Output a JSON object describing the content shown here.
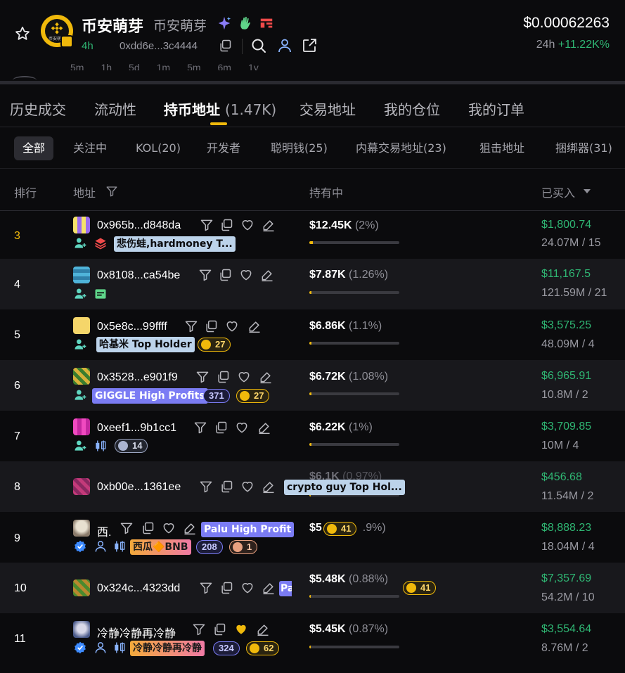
{
  "header": {
    "token_name": "币安萌芽",
    "token_subname": "币安萌芽",
    "logo_text": "币安萌芽",
    "age": "4h",
    "address": "0xdd6e...3c4444",
    "price": "$0.00062263",
    "change_label": "24h",
    "change_value": "+11.22K%"
  },
  "timeframes": [
    "5m",
    "1h",
    "5d",
    "1m",
    "5m",
    "6m",
    "1y"
  ],
  "main_tabs": [
    {
      "label": "历史成交"
    },
    {
      "label": "流动性"
    },
    {
      "label": "持币地址",
      "count": "(1.47K)"
    },
    {
      "label": "交易地址"
    },
    {
      "label": "我的仓位"
    },
    {
      "label": "我的订单"
    }
  ],
  "filters": [
    "全部",
    "关注中",
    "KOL(20)",
    "开发者",
    "聪明钱(25)",
    "内幕交易地址(23)",
    "狙击地址",
    "捆绑器(31)"
  ],
  "columns": {
    "rank": "排行",
    "address": "地址",
    "holding": "持有中",
    "bought": "已买入"
  },
  "rows": [
    {
      "rank": "3",
      "address": "0x965b...d848da",
      "label": "悲伤蛙,hardmoney T...",
      "holding": "$12.45K",
      "pct": "(2%)",
      "share": 0.02,
      "bought": "$1,800.74",
      "bought_sub": "24.07M / 15"
    },
    {
      "rank": "4",
      "address": "0x8108...ca54be",
      "holding": "$7.87K",
      "pct": "(1.26%)",
      "share": 0.0126,
      "bought": "$11,167.5",
      "bought_sub": "121.59M / 21"
    },
    {
      "rank": "5",
      "address": "0x5e8c...99ffff",
      "label": "哈基米 Top Holder",
      "pill": "27",
      "holding": "$6.86K",
      "pct": "(1.1%)",
      "share": 0.011,
      "bought": "$3,575.25",
      "bought_sub": "48.09M / 4"
    },
    {
      "rank": "6",
      "address": "0x3528...e901f9",
      "label": "GIGGLE High Profits",
      "pill_num": "371",
      "pill": "27",
      "holding": "$6.72K",
      "pct": "(1.08%)",
      "share": 0.0108,
      "bought": "$6,965.91",
      "bought_sub": "10.8M / 2"
    },
    {
      "rank": "7",
      "address": "0xeef1...9b1cc1",
      "pill": "14",
      "holding": "$6.22K",
      "pct": "(1%)",
      "share": 0.01,
      "bought": "$3,709.85",
      "bought_sub": "10M / 4"
    },
    {
      "rank": "8",
      "address": "0xb00e...1361ee",
      "label": "crypto guy Top Hol...",
      "holding": "$6.1K",
      "pct": "(0.97%)",
      "share": 0.0097,
      "bought": "$456.68",
      "bought_sub": "11.54M / 2"
    },
    {
      "rank": "9",
      "address": "西.",
      "label": "Palu High Profit",
      "label2": "西瓜🔶BNB",
      "pill_num": "208",
      "pill": "1",
      "pill2": "41",
      "holding": "$5",
      "pct": ".9%)",
      "share": 0.009,
      "bought": "$8,888.23",
      "bought_sub": "18.04M / 4"
    },
    {
      "rank": "10",
      "address": "0x324c...4323dd",
      "label": "Pa",
      "pill": "41",
      "holding": "$5.48K",
      "pct": "(0.88%)",
      "share": 0.0088,
      "bought": "$7,357.69",
      "bought_sub": "54.2M / 10"
    },
    {
      "rank": "11",
      "address": "冷静冷静再冷静",
      "label": "冷静冷静再冷静",
      "pill_num": "324",
      "pill": "62",
      "holding": "$5.45K",
      "pct": "(0.87%)",
      "share": 0.0087,
      "bought": "$3,554.64",
      "bought_sub": "8.76M / 2"
    }
  ],
  "colors": {
    "accent": "#f0b90b",
    "positive": "#2fb673",
    "label_blue": "#bcd3ea",
    "label_purple": "#7b7cf4"
  }
}
